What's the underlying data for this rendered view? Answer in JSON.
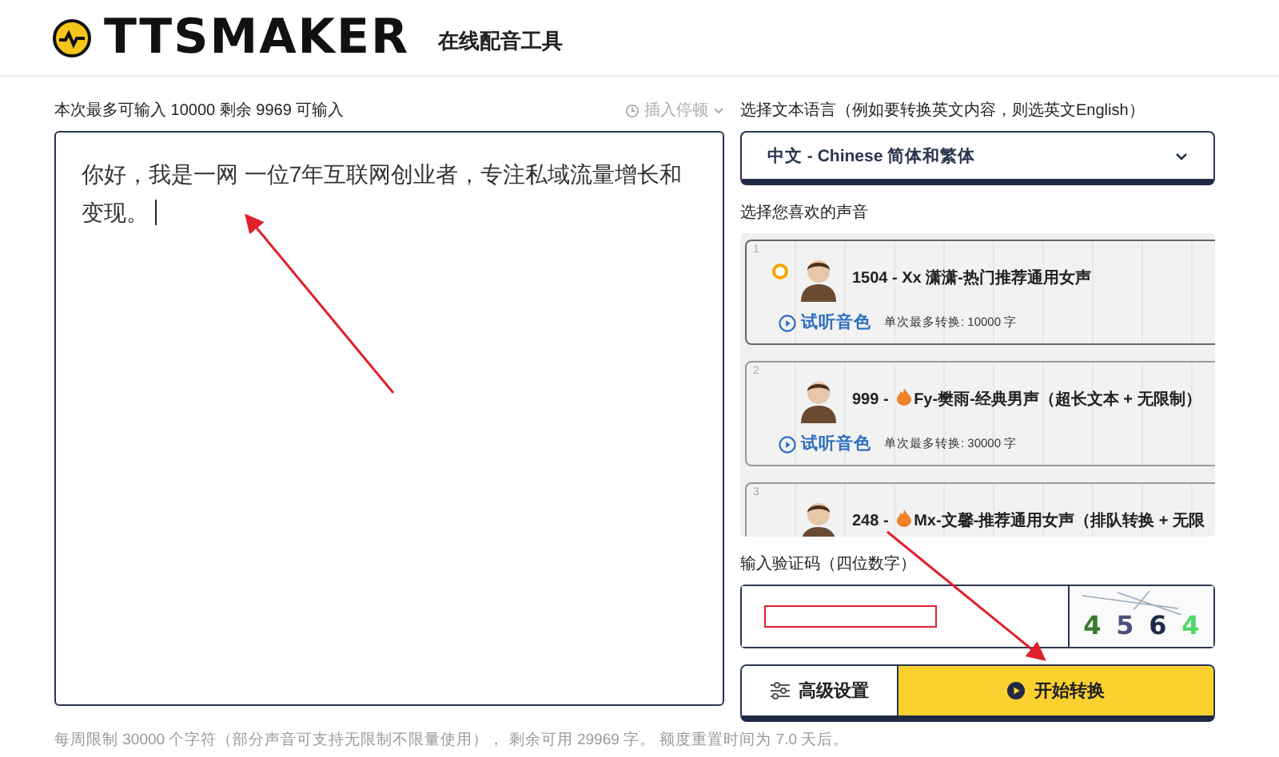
{
  "header": {
    "logo": "TTSMAKER",
    "subtitle": "在线配音工具"
  },
  "editor": {
    "quota": "本次最多可输入 10000 剩余 9969 可输入",
    "insert_pause": "插入停顿",
    "value": "你好，我是一网 一位7年互联网创业者，专注私域流量增长和变现。",
    "note": "每周限制 30000 个字符（部分声音可支持无限制不限量使用）， 剩余可用 29969 字。 额度重置时间为 7.0 天后。"
  },
  "language": {
    "label": "选择文本语言（例如要转换英文内容，则选英文English）",
    "value": "中文 - Chinese 简体和繁体"
  },
  "voices": {
    "label": "选择您喜欢的声音",
    "items": [
      {
        "index": "1",
        "selected": true,
        "prefix": "1504 - ",
        "hot": false,
        "name": "Xx 潇潇-热门推荐通用女声",
        "preview": "试听音色",
        "limit": "单次最多转换: 10000 字"
      },
      {
        "index": "2",
        "selected": false,
        "prefix": "999 - ",
        "hot": true,
        "name": "Fy-樊雨-经典男声（超长文本 + 无限制）",
        "preview": "试听音色",
        "limit": "单次最多转换: 30000 字"
      },
      {
        "index": "3",
        "selected": false,
        "prefix": "248 - ",
        "hot": true,
        "name": "Mx-文馨-推荐通用女声（排队转换 + 无限"
      }
    ]
  },
  "captcha": {
    "label": "输入验证码（四位数字）",
    "digits": [
      {
        "char": "4",
        "color": "#3a7a2e"
      },
      {
        "char": "5",
        "color": "#4a4f7a"
      },
      {
        "char": "6",
        "color": "#1e2a4a"
      },
      {
        "char": "4",
        "color": "#4cd964"
      }
    ]
  },
  "buttons": {
    "settings": "高级设置",
    "start": "开始转换"
  }
}
